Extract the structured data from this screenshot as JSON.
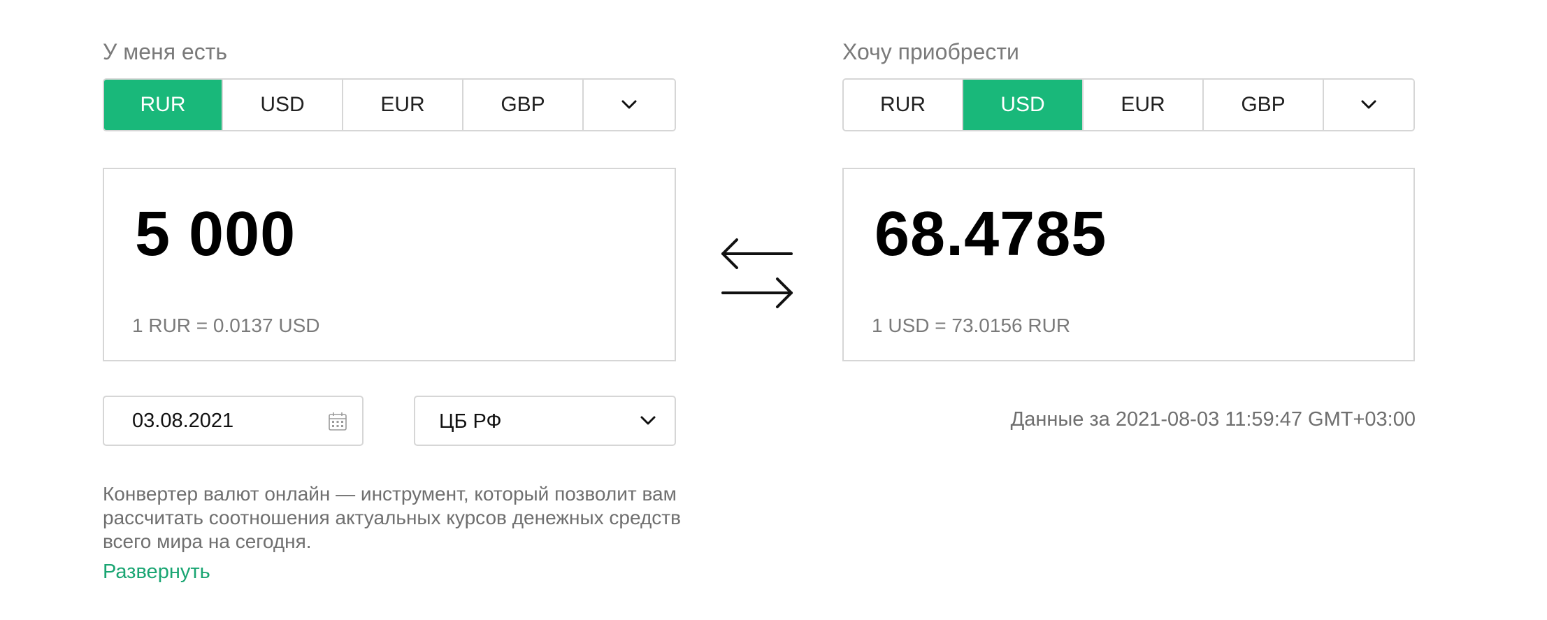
{
  "have_panel": {
    "label": "У меня есть",
    "currencies": [
      "RUR",
      "USD",
      "EUR",
      "GBP"
    ],
    "selected": "RUR",
    "more_icon": "chevron-down-icon",
    "amount": "5 000",
    "rate": "1 RUR = 0.0137 USD"
  },
  "want_panel": {
    "label": "Хочу приобрести",
    "currencies": [
      "RUR",
      "USD",
      "EUR",
      "GBP"
    ],
    "selected": "USD",
    "more_icon": "chevron-down-icon",
    "amount": "68.4785",
    "rate": "1 USD = 73.0156 RUR"
  },
  "swap_icon": "swap-arrows-icon",
  "date": {
    "value": "03.08.2021",
    "icon": "calendar-icon"
  },
  "source": {
    "value": "ЦБ РФ",
    "icon": "chevron-down-icon"
  },
  "timestamp": "Данные за 2021-08-03 11:59:47 GMT+03:00",
  "description": "Конвертер валют онлайн — инструмент, который позволит вам рассчитать соотношения актуальных курсов денежных средств всего мира на сегодня.",
  "expand_link": "Развернуть",
  "colors": {
    "accent": "#19b87a",
    "link": "#19a572",
    "border": "#d6d6d6",
    "muted_text": "#7a7a7a"
  }
}
